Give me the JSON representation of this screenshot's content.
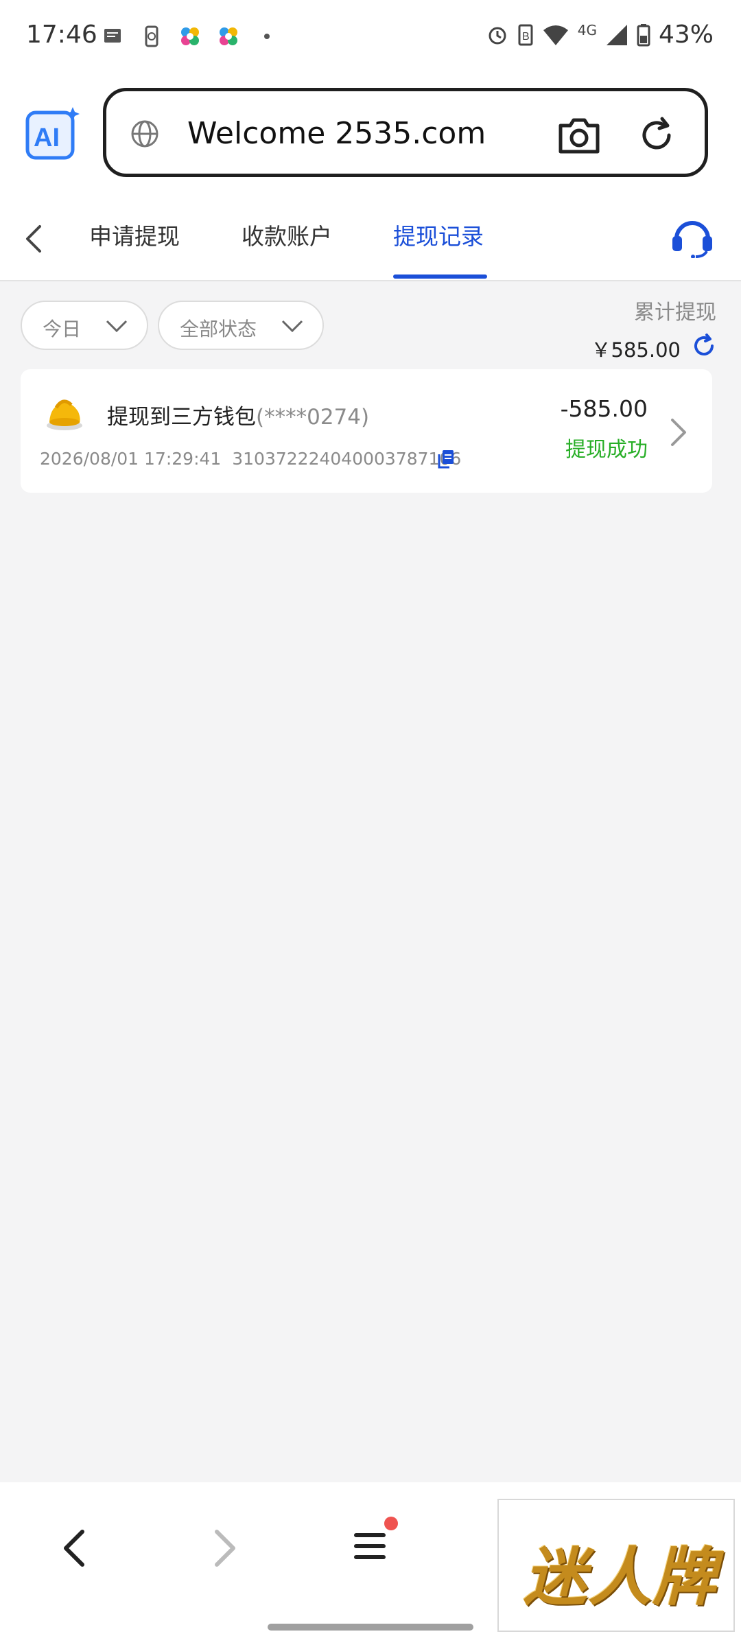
{
  "status_bar": {
    "time": "17:46",
    "network": "4G",
    "battery": "43%"
  },
  "browser": {
    "url": "Welcome 2535.com",
    "icons": [
      "ai-logo-icon",
      "globe-icon",
      "camera-icon",
      "reload-icon"
    ]
  },
  "header": {
    "tabs": [
      {
        "label": "申请提现"
      },
      {
        "label": "收款账户"
      },
      {
        "label": "提现记录"
      }
    ],
    "active_tab": "提现记录"
  },
  "filters": {
    "date_label": "今日",
    "status_label": "全部状态"
  },
  "summary": {
    "label": "累计提现",
    "amount": "￥585.00"
  },
  "records": [
    {
      "title": "提现到三方钱包",
      "account_mask": "(****0274)",
      "datetime": "2026/08/01 17:29:41",
      "order_no": "3103722240400037871 06",
      "order_display": "310372224040003787106",
      "amount": "-585.00",
      "status": "提现成功"
    }
  ],
  "ad": {
    "text": "迷人牌"
  },
  "colors": {
    "accent": "#1b4fd8",
    "success": "#27ae26",
    "background": "#f4f4f5",
    "notification_dot": "#ef5350"
  }
}
